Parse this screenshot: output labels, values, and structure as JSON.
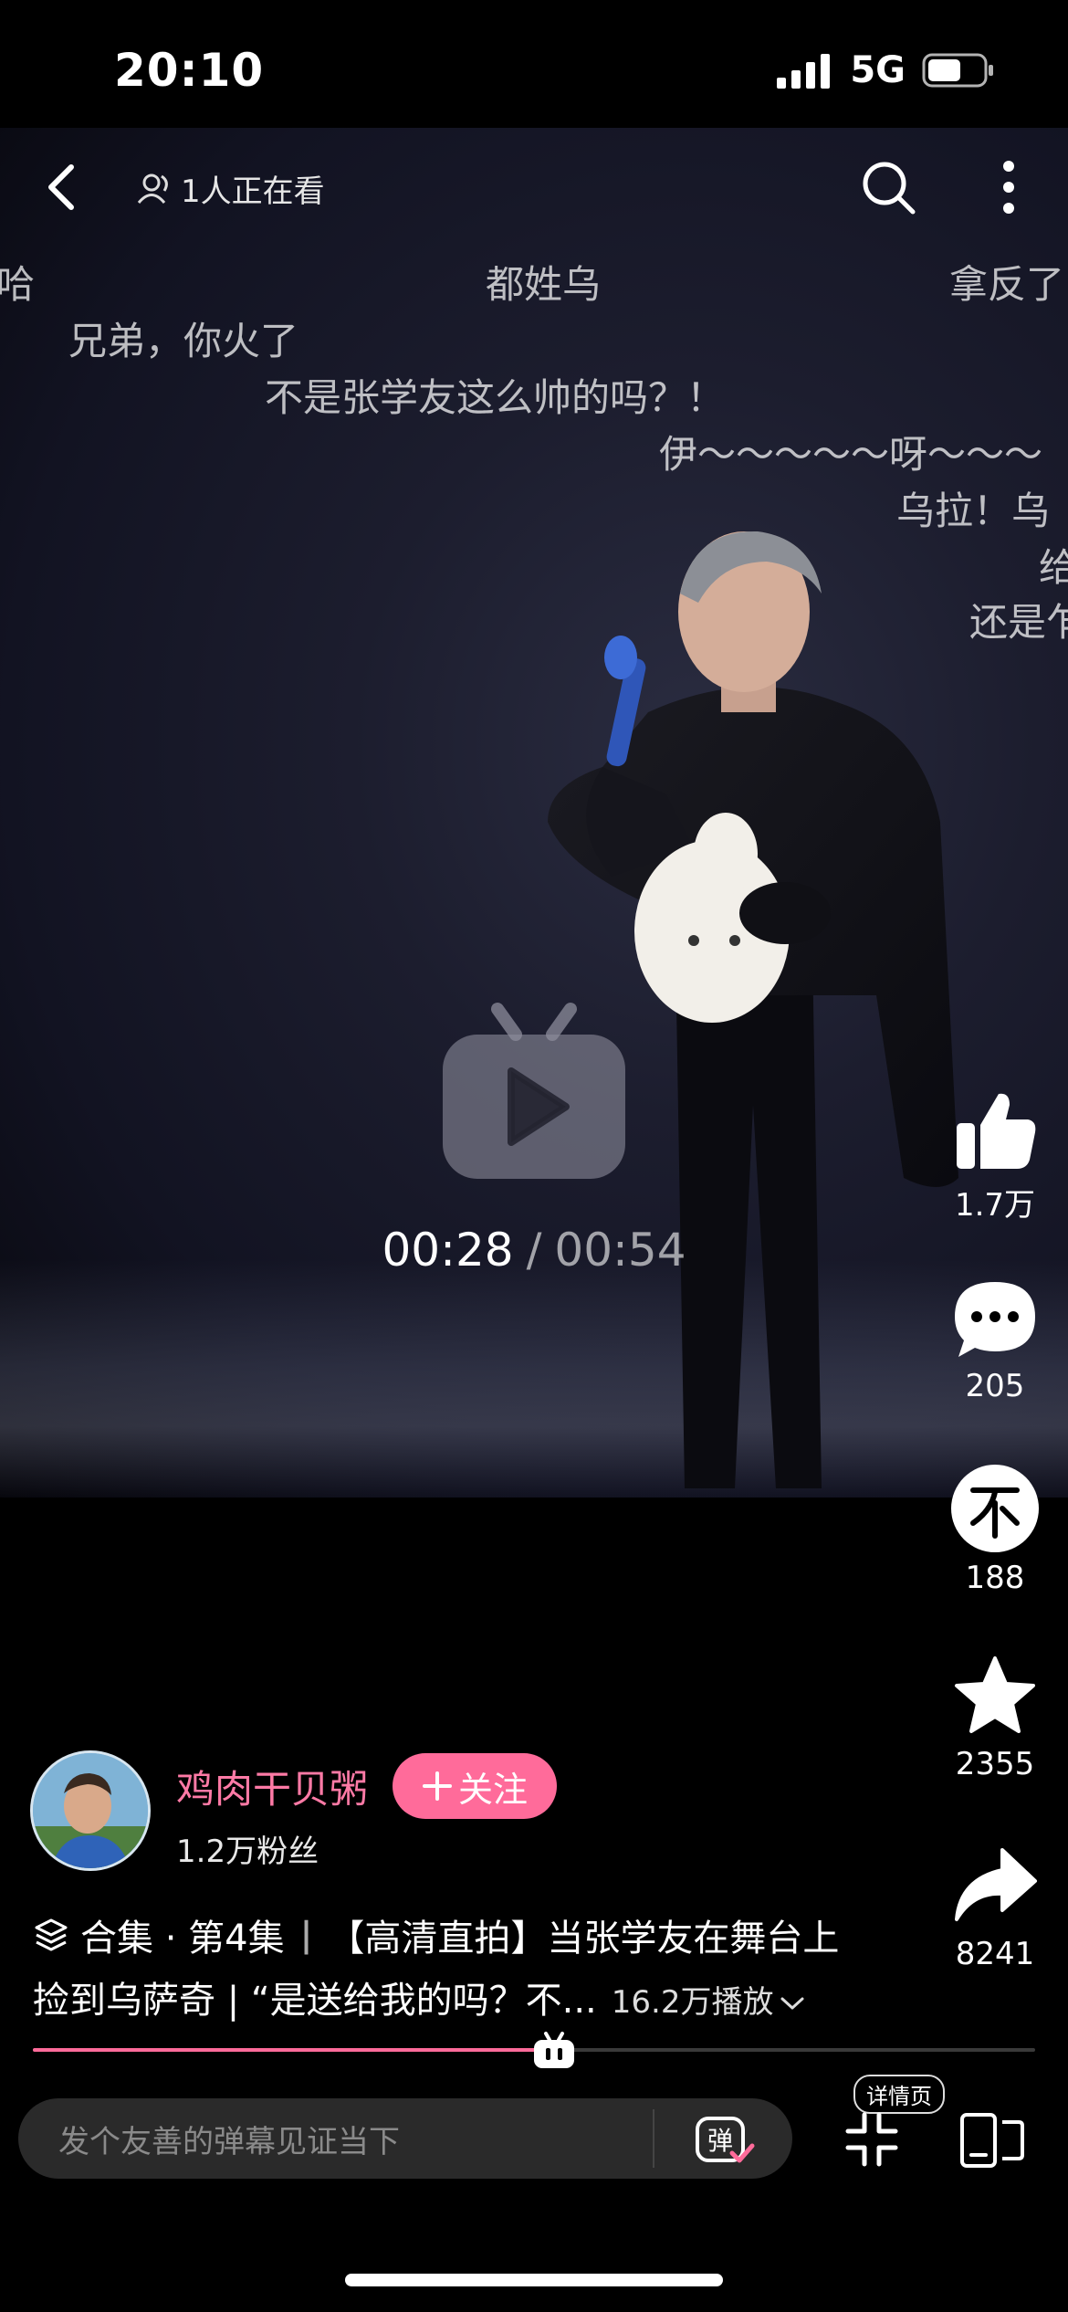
{
  "status_bar": {
    "time": "20:10",
    "network": "5G",
    "battery_level": 0.6
  },
  "top_nav": {
    "viewers": "1人正在看"
  },
  "danmaku": [
    "哈",
    "都姓乌",
    "拿反了",
    "兄弟，你火了",
    "不是张学友这么帅的吗？！",
    "伊～～～～～呀～～～",
    "乌拉！乌",
    "给",
    "还是乍"
  ],
  "player": {
    "current_time": "00:28",
    "separator": "/",
    "total_time": "00:54",
    "progress": 0.52
  },
  "actions": {
    "likes": "1.7万",
    "comments": "205",
    "coins": "188",
    "favorites": "2355",
    "shares": "8241"
  },
  "author": {
    "name": "鸡肉干贝粥",
    "follow_label": "关注",
    "fans": "1.2万粉丝"
  },
  "video": {
    "collection": "合集 · 第4集",
    "title_line1": "【高清直拍】当张学友在舞台上",
    "title_line2": "捡到乌萨奇 | “是送给我的吗？不...",
    "plays": "16.2万播放"
  },
  "bottom_bar": {
    "placeholder": "发个友善的弹幕见证当下",
    "details_label": "详情页"
  },
  "colors": {
    "accent": "#ff6b9a",
    "background": "#000000"
  }
}
